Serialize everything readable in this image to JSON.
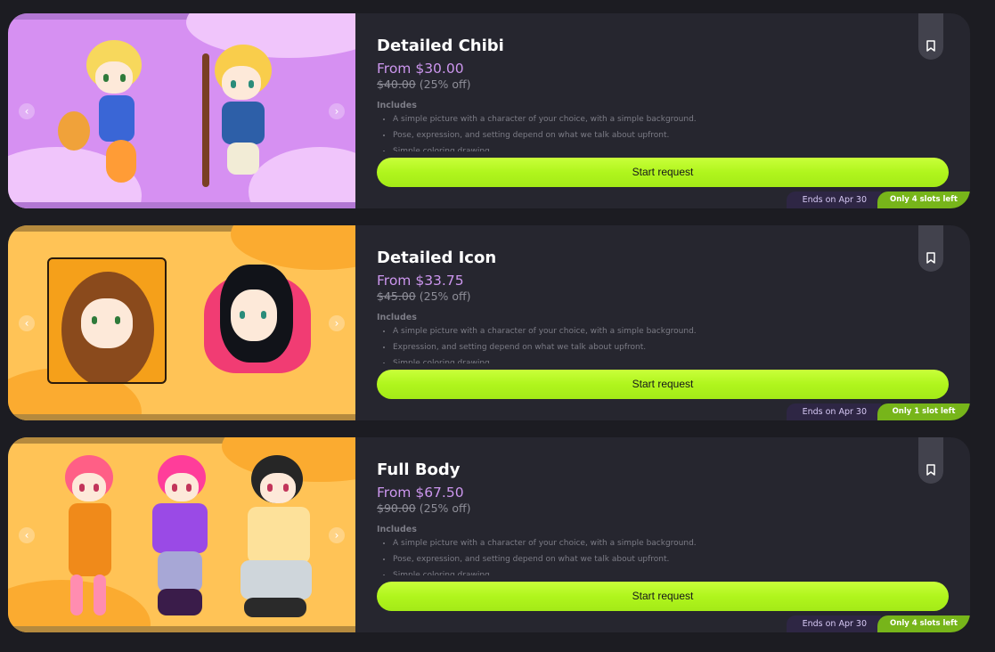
{
  "cards": [
    {
      "title": "Detailed Chibi",
      "price": "From $30.00",
      "original_price": "$40.00",
      "discount": "(25% off)",
      "includes_label": "Includes",
      "includes": [
        "A simple picture with a character of your choice, with a simple background.",
        "Pose, expression, and setting depend on what we talk about upfront.",
        "Simple coloring drawing"
      ],
      "button_label": "Start request",
      "ends": "Ends on Apr 30",
      "slots": "Only 4 slots left",
      "slide_count": 2,
      "active_slide": 0
    },
    {
      "title": "Detailed Icon",
      "price": "From $33.75",
      "original_price": "$45.00",
      "discount": "(25% off)",
      "includes_label": "Includes",
      "includes": [
        "A simple picture with a character of your choice, with a simple background.",
        "Expression, and setting depend on what we talk about upfront.",
        "Simple coloring drawing"
      ],
      "button_label": "Start request",
      "ends": "Ends on Apr 30",
      "slots": "Only 1 slot left",
      "slide_count": 4,
      "active_slide": 0
    },
    {
      "title": "Full Body",
      "price": "From $67.50",
      "original_price": "$90.00",
      "discount": "(25% off)",
      "includes_label": "Includes",
      "includes": [
        "A simple picture with a character of your choice, with a simple background.",
        "Pose, expression, and setting depend on what we talk about upfront.",
        "Simple coloring drawing"
      ],
      "button_label": "Start request",
      "ends": "Ends on Apr 30",
      "slots": "Only 4 slots left",
      "slide_count": 2,
      "active_slide": 0
    }
  ],
  "icons": {
    "bookmark": "bookmark-icon",
    "prev": "chevron-left-icon",
    "next": "chevron-right-icon"
  },
  "colors": {
    "accent_button": "#b4f521",
    "price": "#cc96ee",
    "slots_badge": "#77b51a",
    "ends_badge": "#2e2644"
  }
}
